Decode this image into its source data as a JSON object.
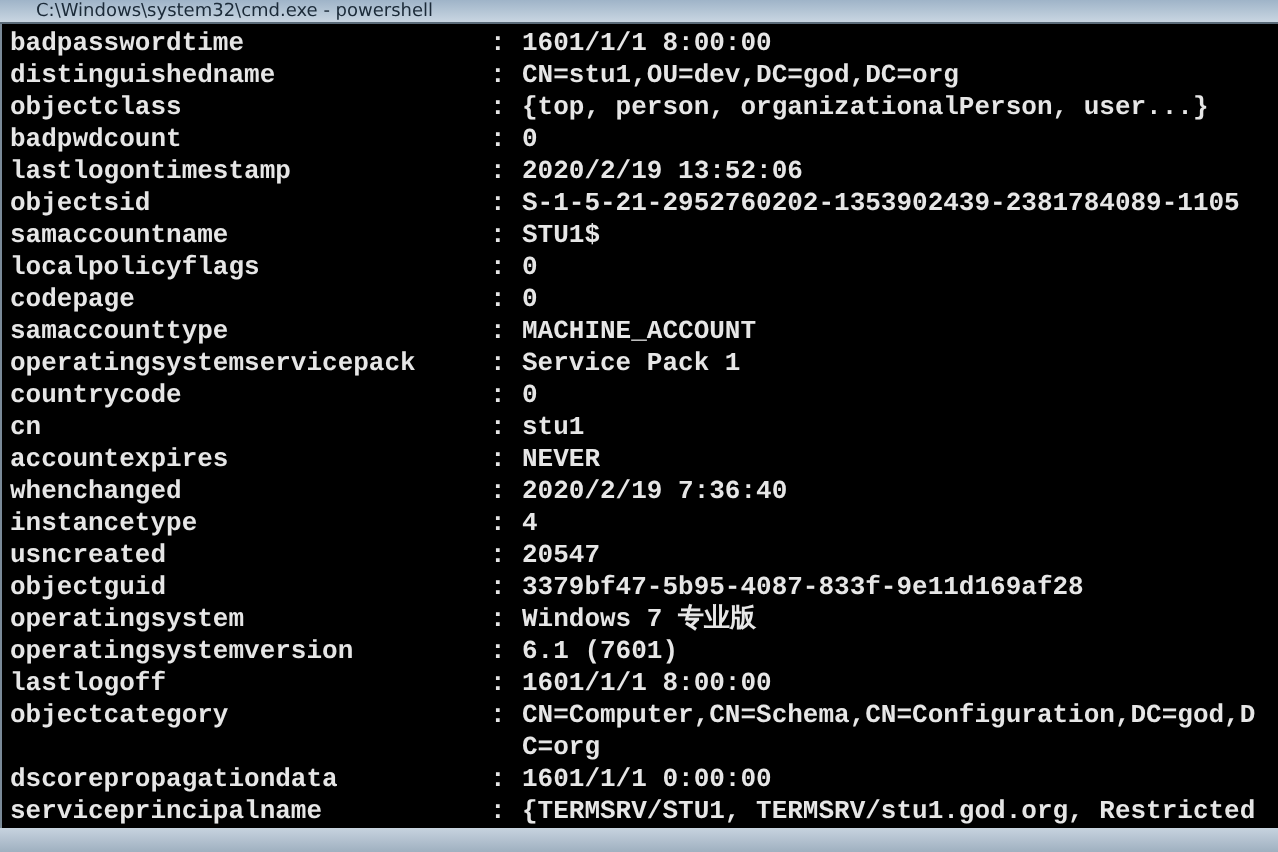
{
  "window": {
    "title": "C:\\Windows\\system32\\cmd.exe - powershell"
  },
  "properties": [
    {
      "name": "badpasswordtime",
      "separator": ":",
      "value": "1601/1/1 8:00:00"
    },
    {
      "name": "distinguishedname",
      "separator": ":",
      "value": "CN=stu1,OU=dev,DC=god,DC=org"
    },
    {
      "name": "objectclass",
      "separator": ":",
      "value": "{top, person, organizationalPerson, user...}"
    },
    {
      "name": "badpwdcount",
      "separator": ":",
      "value": "0"
    },
    {
      "name": "lastlogontimestamp",
      "separator": ":",
      "value": "2020/2/19 13:52:06"
    },
    {
      "name": "objectsid",
      "separator": ":",
      "value": "S-1-5-21-2952760202-1353902439-2381784089-1105"
    },
    {
      "name": "samaccountname",
      "separator": ":",
      "value": "STU1$"
    },
    {
      "name": "localpolicyflags",
      "separator": ":",
      "value": "0"
    },
    {
      "name": "codepage",
      "separator": ":",
      "value": "0"
    },
    {
      "name": "samaccounttype",
      "separator": ":",
      "value": "MACHINE_ACCOUNT"
    },
    {
      "name": "operatingsystemservicepack",
      "separator": ":",
      "value": "Service Pack 1"
    },
    {
      "name": "countrycode",
      "separator": ":",
      "value": "0"
    },
    {
      "name": "cn",
      "separator": ":",
      "value": "stu1"
    },
    {
      "name": "accountexpires",
      "separator": ":",
      "value": "NEVER"
    },
    {
      "name": "whenchanged",
      "separator": ":",
      "value": "2020/2/19 7:36:40"
    },
    {
      "name": "instancetype",
      "separator": ":",
      "value": "4"
    },
    {
      "name": "usncreated",
      "separator": ":",
      "value": "20547"
    },
    {
      "name": "objectguid",
      "separator": ":",
      "value": "3379bf47-5b95-4087-833f-9e11d169af28"
    },
    {
      "name": "operatingsystem",
      "separator": ":",
      "value": "Windows 7 专业版"
    },
    {
      "name": "operatingsystemversion",
      "separator": ":",
      "value": "6.1 (7601)"
    },
    {
      "name": "lastlogoff",
      "separator": ":",
      "value": "1601/1/1 8:00:00"
    },
    {
      "name": "objectcategory",
      "separator": ":",
      "value": "CN=Computer,CN=Schema,CN=Configuration,DC=god,DC=org"
    },
    {
      "name": "dscorepropagationdata",
      "separator": ":",
      "value": "1601/1/1 0:00:00"
    },
    {
      "name": "serviceprincipalname",
      "separator": ":",
      "value": "{TERMSRV/STU1, TERMSRV/stu1.god.org, Restricted"
    }
  ]
}
